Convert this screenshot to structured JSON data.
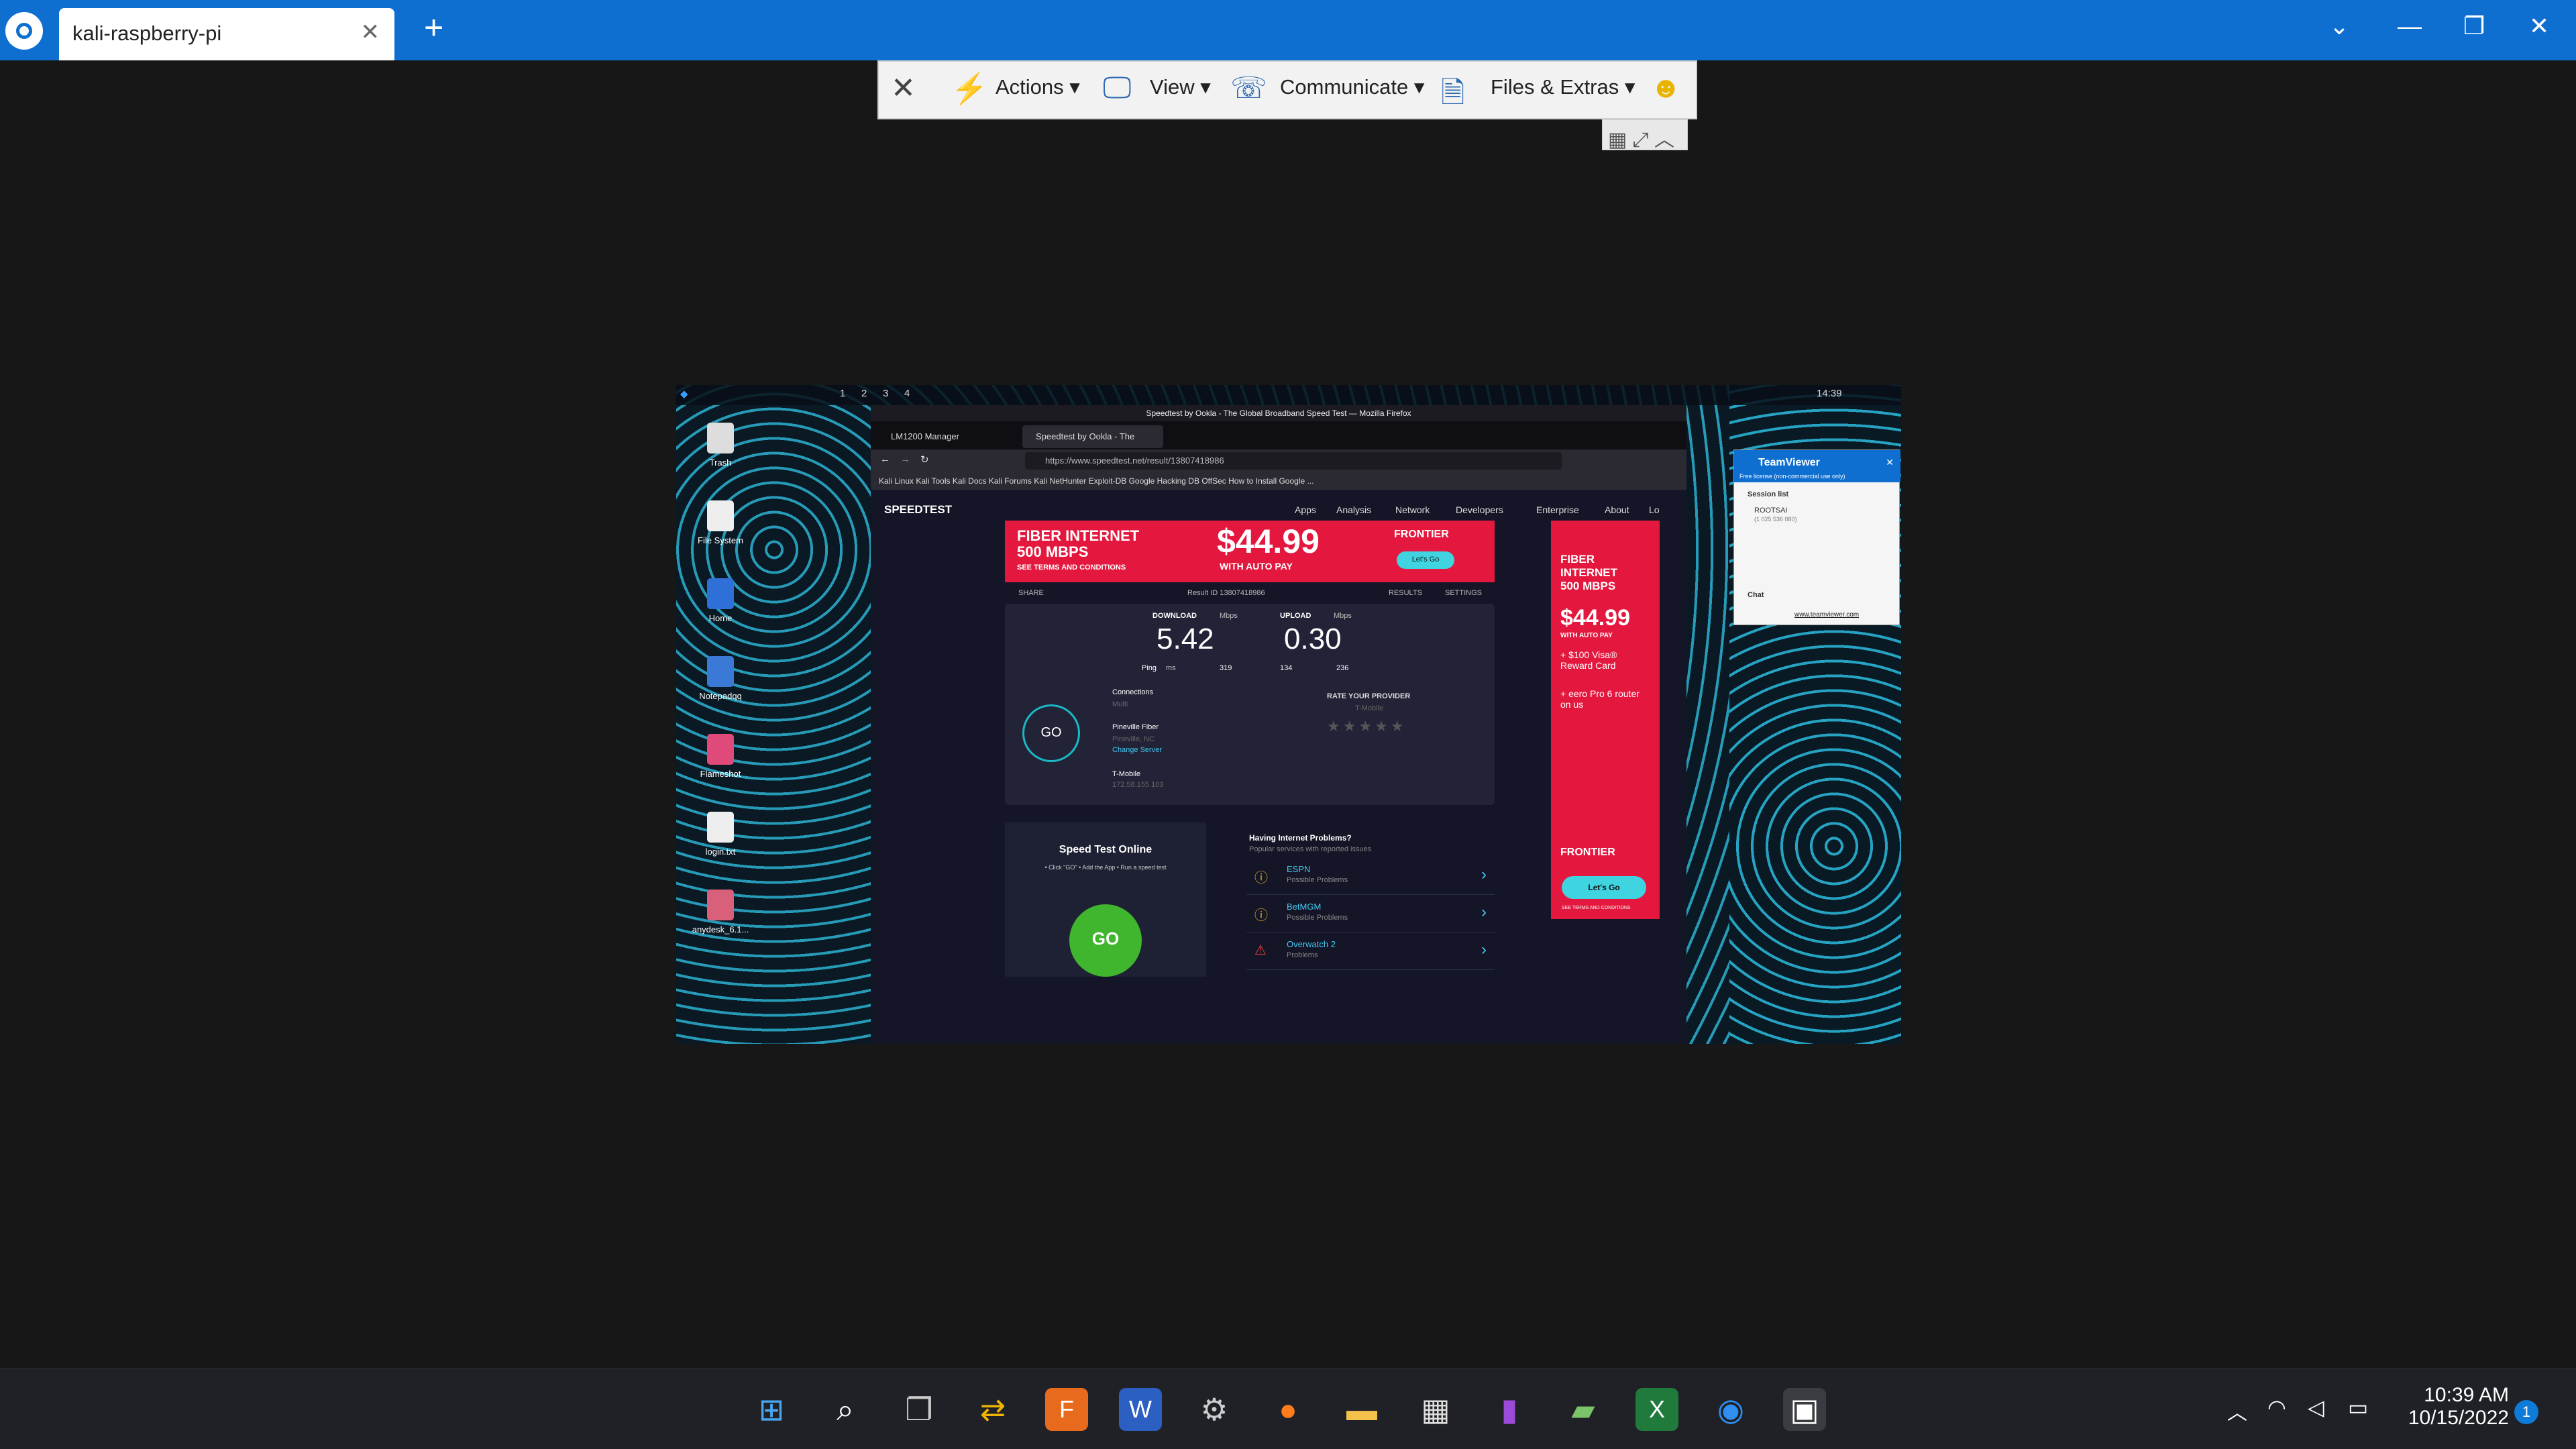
{
  "window": {
    "tab_title": "kali-raspberry-pi",
    "new_tab": "+",
    "ctl_dropdown": "⌄",
    "ctl_min": "—",
    "ctl_max": "❐",
    "ctl_close": "✕"
  },
  "toolbar": {
    "close": "✕",
    "actions": "Actions",
    "view": "View",
    "communicate": "Communicate",
    "files": "Files & Extras",
    "caret": "▾",
    "smiley": "☻",
    "mini": "▦ ⤢ ︿"
  },
  "remote": {
    "kali_bar": {
      "workspaces": [
        "1",
        "2",
        "3",
        "4"
      ],
      "clock": "14:39"
    },
    "desktop_icons": [
      "Trash",
      "File System",
      "Home",
      "Notepadqq",
      "Flameshot",
      "login.txt",
      "anydesk_6.1..."
    ],
    "firefox": {
      "title": "Speedtest by Ookla - The Global Broadband Speed Test — Mozilla Firefox",
      "tabs": [
        "LM1200 Manager",
        "Speedtest by Ookla - The"
      ],
      "url": "https://www.speedtest.net/result/13807418986",
      "bookmarks": "Kali Linux   Kali Tools   Kali Docs   Kali Forums   Kali NetHunter   Exploit-DB   Google Hacking DB   OffSec   How to Install Google ...",
      "speedtest": {
        "logo": "SPEEDTEST",
        "nav": [
          "Apps",
          "Analysis",
          "Network",
          "Developers",
          "Enterprise",
          "About",
          "Lo"
        ],
        "ad_top": {
          "l1": "FIBER INTERNET",
          "l2": "500 MBPS",
          "l3": "SEE TERMS AND CONDITIONS",
          "price": "$44.99",
          "sub": "WITH AUTO PAY",
          "brand": "FRONTIER",
          "cta": "Let's Go"
        },
        "ad_side": {
          "l1": "FIBER",
          "l2": "INTERNET",
          "l3": "500 MBPS",
          "price": "$44.99",
          "sub": "WITH AUTO PAY",
          "b1": "+ $100 Visa® Reward Card",
          "b2": "+ eero Pro 6 router on us",
          "brand": "FRONTIER",
          "cta": "Let's Go",
          "terms": "SEE TERMS AND CONDITIONS"
        },
        "share": "SHARE",
        "result_id": "Result ID 13807418986",
        "results": "RESULTS",
        "settings": "SETTINGS",
        "download_label": "DOWNLOAD",
        "upload_label": "UPLOAD",
        "unit": "Mbps",
        "download": "5.42",
        "upload": "0.30",
        "ping_label": "Ping",
        "ping_unit": "ms",
        "ping": "319",
        "jitter": "134",
        "loss": "236",
        "connections_label": "Connections",
        "connections_value": "Multi",
        "server": "Pineville Fiber",
        "server_loc": "Pineville, NC",
        "change_server": "Change Server",
        "isp": "T-Mobile",
        "ip": "172.58.155.103",
        "rate": "RATE YOUR PROVIDER",
        "rate_isp": "T-Mobile",
        "stars": "★★★★★",
        "go": "GO",
        "ad2_title": "Speed Test Online",
        "ad2_steps": "• Click \"GO\"   • Add the App   • Run a speed test",
        "ad2_go": "GO",
        "problems_title": "Having Internet Problems?",
        "problems_sub": "Popular services with reported issues",
        "problems": [
          {
            "name": "ESPN",
            "status": "Possible Problems"
          },
          {
            "name": "BetMGM",
            "status": "Possible Problems"
          },
          {
            "name": "Overwatch 2",
            "status": "Problems"
          }
        ]
      }
    },
    "tv_panel": {
      "title": "TeamViewer",
      "license": "Free license (non-commercial use only)",
      "session_list": "Session list",
      "session_name": "ROOTSAI",
      "session_id": "(1 025 536 080)",
      "chat": "Chat",
      "link": "www.teamviewer.com"
    }
  },
  "taskbar": {
    "time": "10:39 AM",
    "date": "10/15/2022",
    "notifications": "1",
    "tray_up": "︿"
  }
}
